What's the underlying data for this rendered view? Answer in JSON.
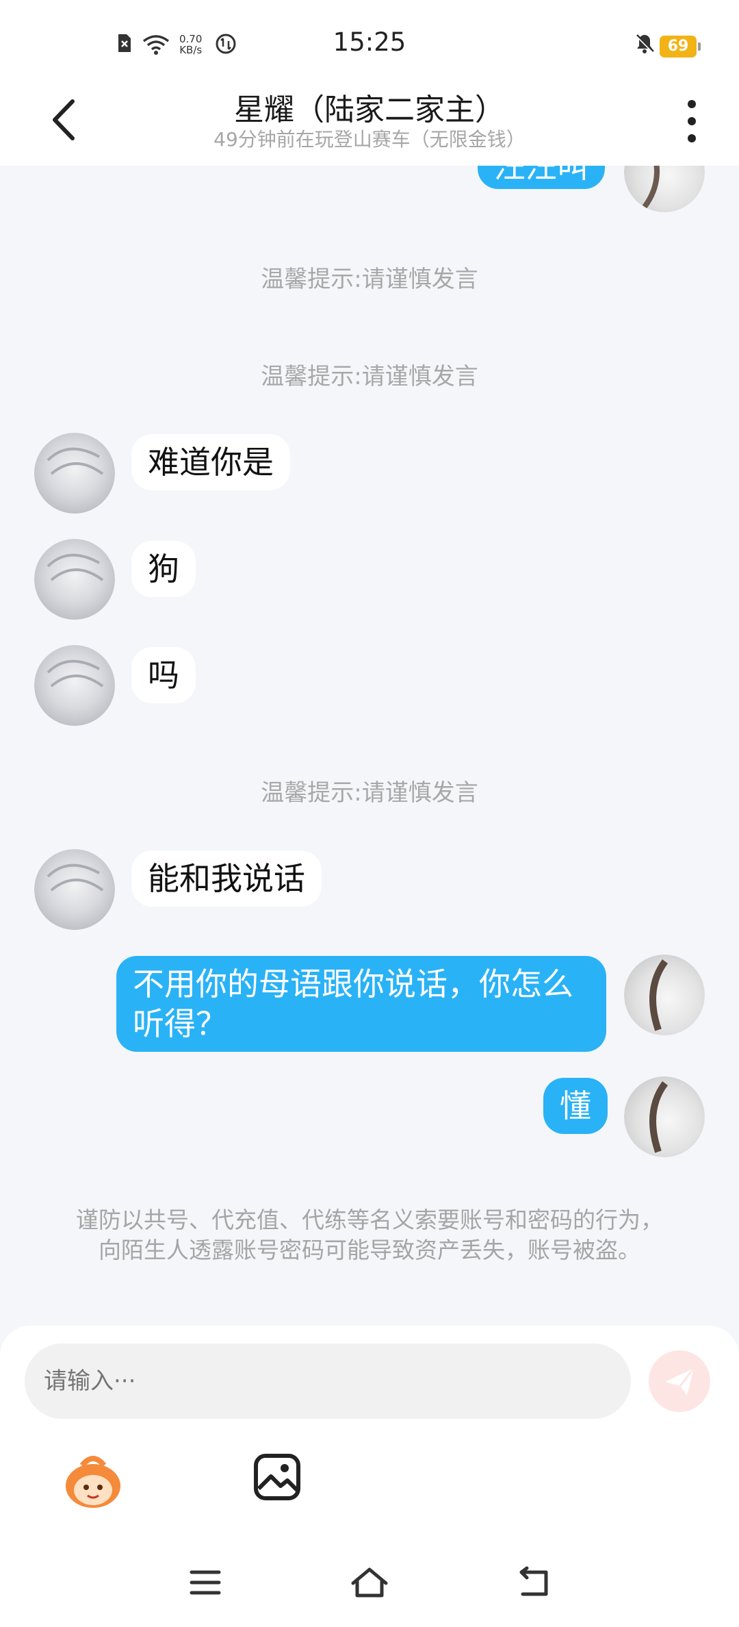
{
  "status_bar": {
    "time": "15:25",
    "net_speed_value": "0.70",
    "net_speed_unit": "KB/s",
    "battery": "69",
    "icons": [
      "sim-error-icon",
      "wifi-icon",
      "data-saver-icon",
      "mute-icon",
      "battery-icon"
    ]
  },
  "header": {
    "title": "星耀（陆家二家主）",
    "subtitle": "49分钟前在玩登山赛车（无限金钱）"
  },
  "messages": {
    "top_partial": "汪汪叫",
    "hint1": "温馨提示:请谨慎发言",
    "hint2": "温馨提示:请谨慎发言",
    "m1": "难道你是",
    "m2": "狗",
    "m3": "吗",
    "hint3": "温馨提示:请谨慎发言",
    "m4": "能和我说话",
    "r1": "不用你的母语跟你说话，你怎么听得？",
    "r2": "懂"
  },
  "notice": "谨防以共号、代充值、代练等名义索要账号和密码的行为，向陌生人透露账号密码可能导致资产丢失，账号被盗。",
  "input": {
    "placeholder": "请输入···"
  },
  "colors": {
    "accent_blue": "#2ab2f6",
    "background": "#f4f6f9",
    "send_button": "#fde5e3",
    "battery": "#f2b316"
  }
}
